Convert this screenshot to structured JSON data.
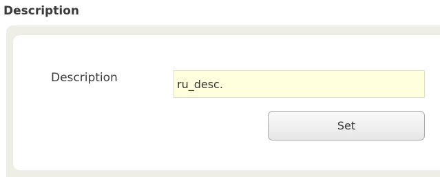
{
  "section": {
    "heading": "Description"
  },
  "form": {
    "description_label": "Description",
    "description_value": "ru_desc.",
    "set_label": "Set"
  }
}
